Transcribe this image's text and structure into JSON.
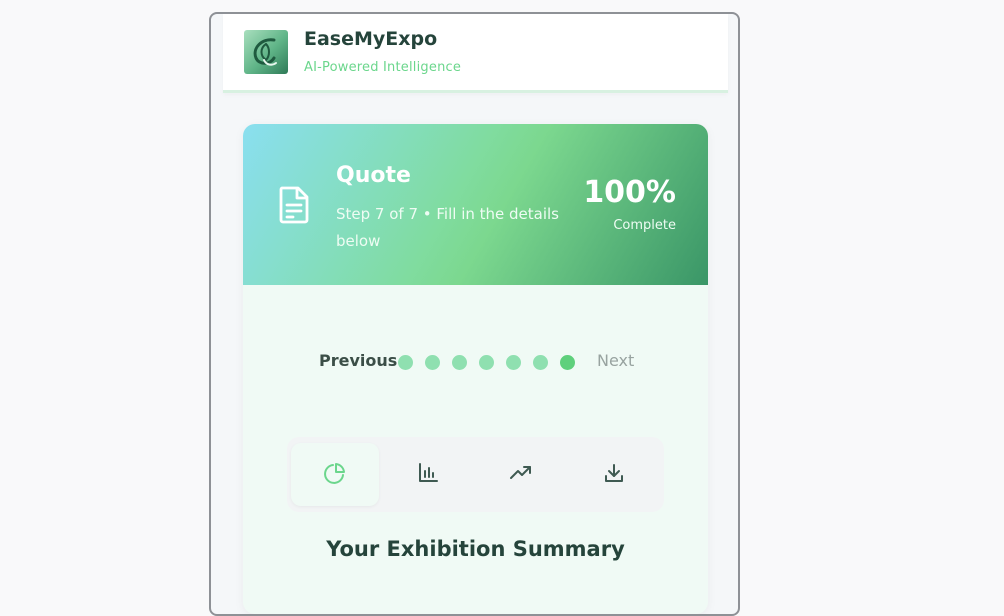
{
  "header": {
    "brand_name": "EaseMyExpo",
    "tagline": "AI-Powered Intelligence",
    "logo_icon": "leaf-logo"
  },
  "hero": {
    "icon": "document-icon",
    "title": "Quote",
    "subtitle": "Step 7 of 7 • Fill in the details below",
    "percent": "100%",
    "percent_label": "Complete",
    "progress_fraction": 1.0
  },
  "stepper": {
    "previous_label": "Previous",
    "next_label": "Next",
    "total_steps": 7,
    "current_step": 7
  },
  "tabs": [
    {
      "icon": "pie-chart-icon",
      "active": true
    },
    {
      "icon": "bar-chart-icon",
      "active": false
    },
    {
      "icon": "trending-up-icon",
      "active": false
    },
    {
      "icon": "download-icon",
      "active": false
    }
  ],
  "summary": {
    "title": "Your Exhibition Summary"
  },
  "colors": {
    "accent": "#6bd68c",
    "active_dot": "#5fd07c",
    "inactive_dot": "#8fe0b0",
    "heading": "#25443b"
  }
}
